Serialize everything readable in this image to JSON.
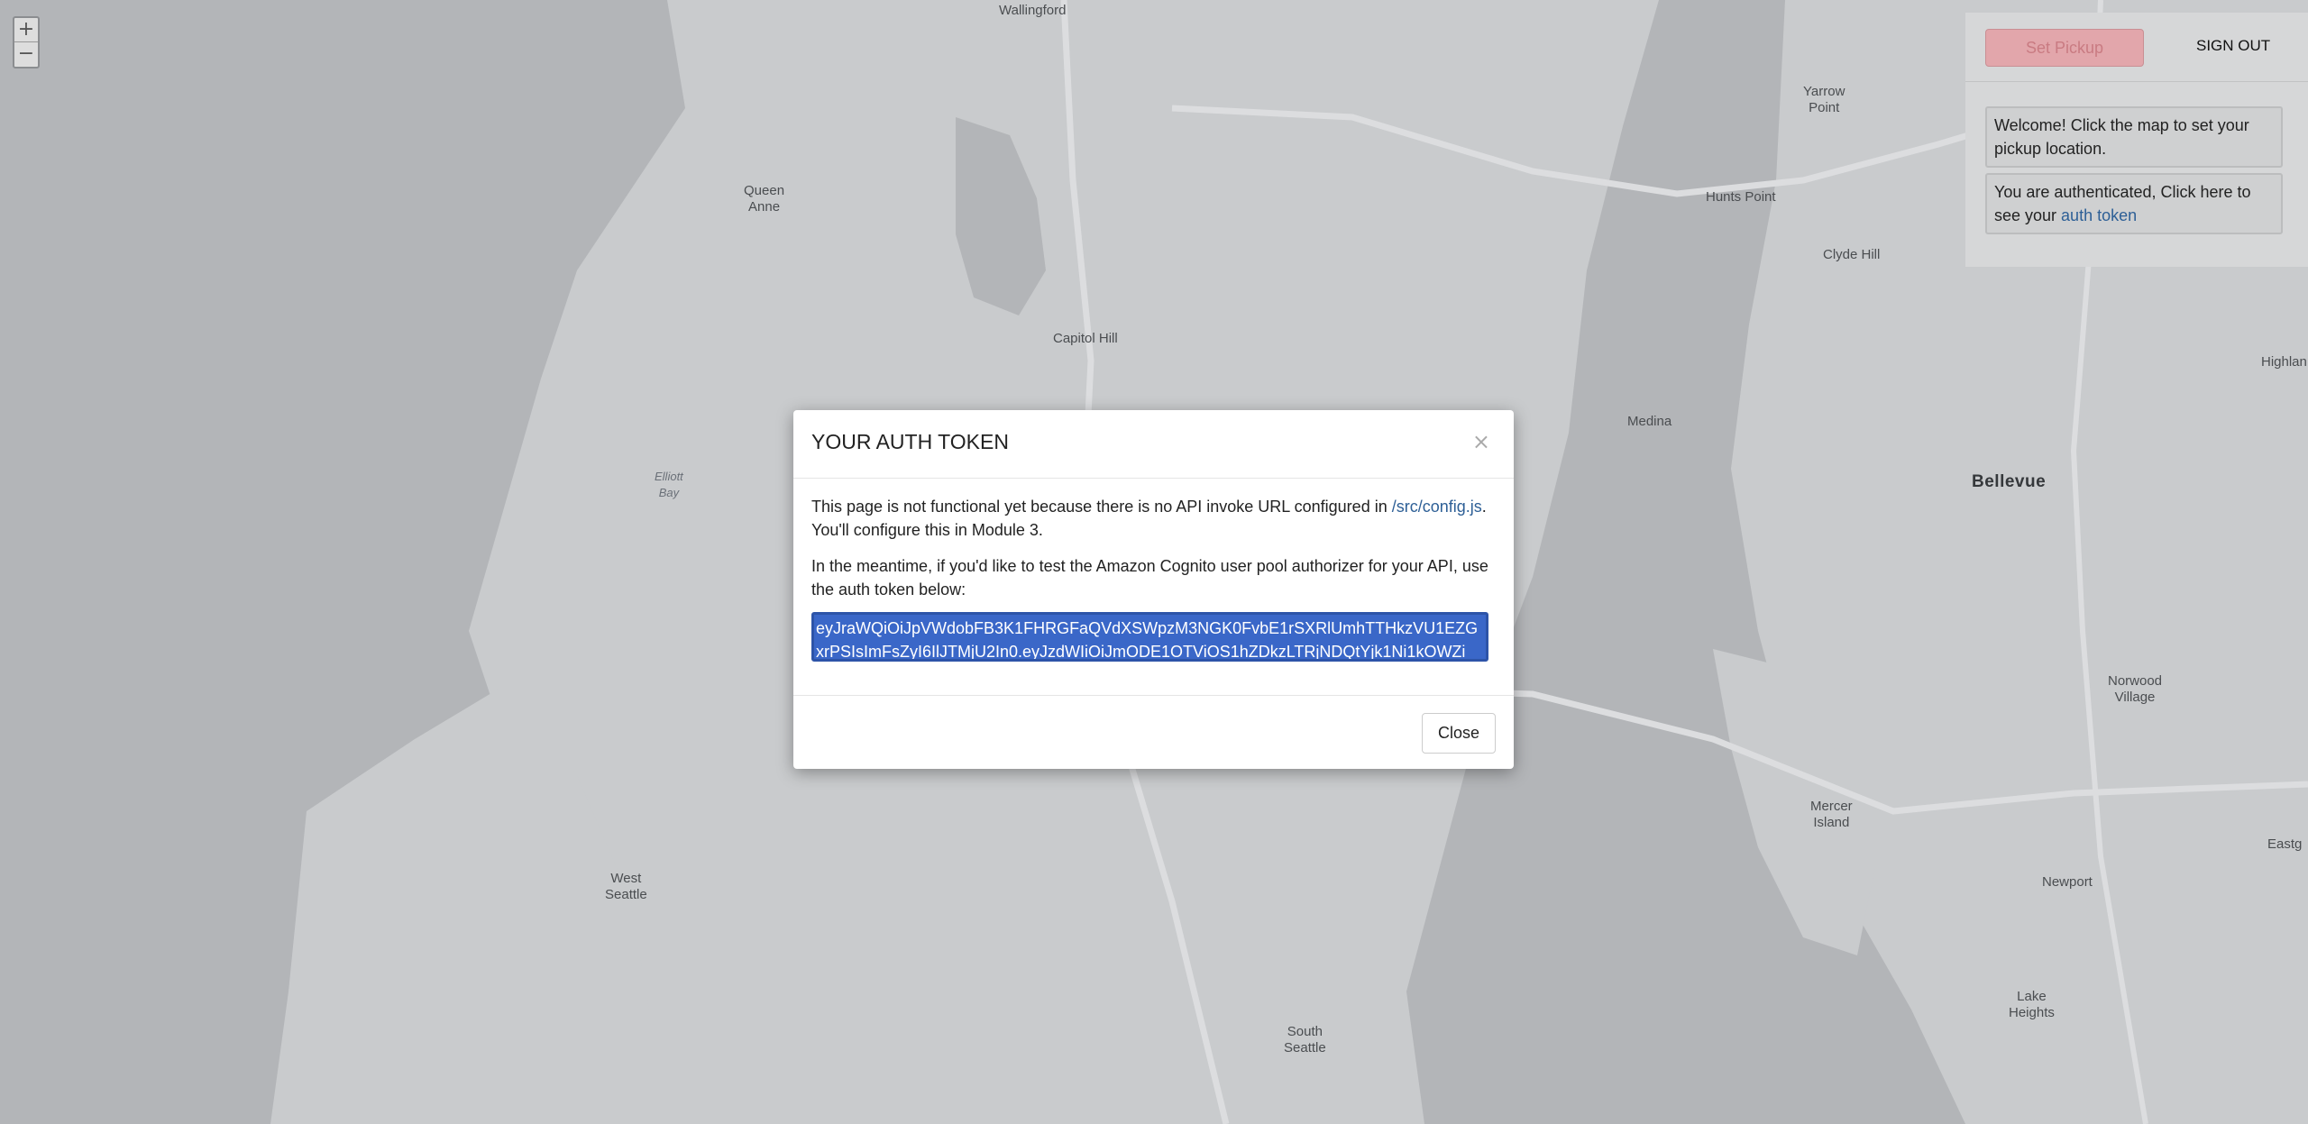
{
  "map": {
    "places": [
      {
        "id": "wallingford",
        "label": "Wallingford"
      },
      {
        "id": "yarrow-point",
        "label": "Yarrow\nPoint"
      },
      {
        "id": "queen-anne",
        "label": "Queen\nAnne"
      },
      {
        "id": "hunts-point",
        "label": "Hunts Point"
      },
      {
        "id": "clyde-hill",
        "label": "Clyde Hill"
      },
      {
        "id": "capitol-hill",
        "label": "Capitol Hill"
      },
      {
        "id": "highlands",
        "label": "Highlan"
      },
      {
        "id": "medina",
        "label": "Medina"
      },
      {
        "id": "elliott-bay",
        "label": "Elliott\nBay"
      },
      {
        "id": "bellevue",
        "label": "Bellevue"
      },
      {
        "id": "norwood-village",
        "label": "Norwood\nVillage"
      },
      {
        "id": "mercer-island",
        "label": "Mercer\nIsland"
      },
      {
        "id": "eastgate",
        "label": "Eastg"
      },
      {
        "id": "west-seattle",
        "label": "West\nSeattle"
      },
      {
        "id": "newport",
        "label": "Newport"
      },
      {
        "id": "lake-heights",
        "label": "Lake\nHeights"
      },
      {
        "id": "south-seattle",
        "label": "South\nSeattle"
      }
    ],
    "zoom_in": "+",
    "zoom_out": "−"
  },
  "sidebar": {
    "set_pickup_label": "Set Pickup",
    "sign_out_label": "SIGN OUT",
    "welcome_message": "Welcome! Click the map to set your pickup location.",
    "auth_message_prefix": "You are authenticated, Click here to see your ",
    "auth_link": "auth token"
  },
  "modal": {
    "title": "YOUR AUTH TOKEN",
    "close_x": "×",
    "para1_prefix": "This page is not functional yet because there is no API invoke URL configured in ",
    "para1_link": "/src/config.js",
    "para1_suffix": ". You'll configure this in Module 3.",
    "para2": "In the meantime, if you'd like to test the Amazon Cognito user pool authorizer for your API, use the auth token below:",
    "token": "eyJraWQiOiJpVWdobFB3K1FHRGFaQVdXSWpzM3NGK0FvbE1rSXRlUmhTTHkzVU1EZGxrPSIsImFsZyI6IlJTMjU2In0.eyJzdWIiOiJmODE1OTViOS1hZDkzLTRjNDQtYjk1Ni1kOWZi",
    "close_label": "Close"
  },
  "colors": {
    "top_bar": "#2a64b2",
    "map_land": "#c9cbcd",
    "map_water": "#b3b5b8",
    "link": "#2d5f96",
    "token_selection": "#3a67c8"
  }
}
